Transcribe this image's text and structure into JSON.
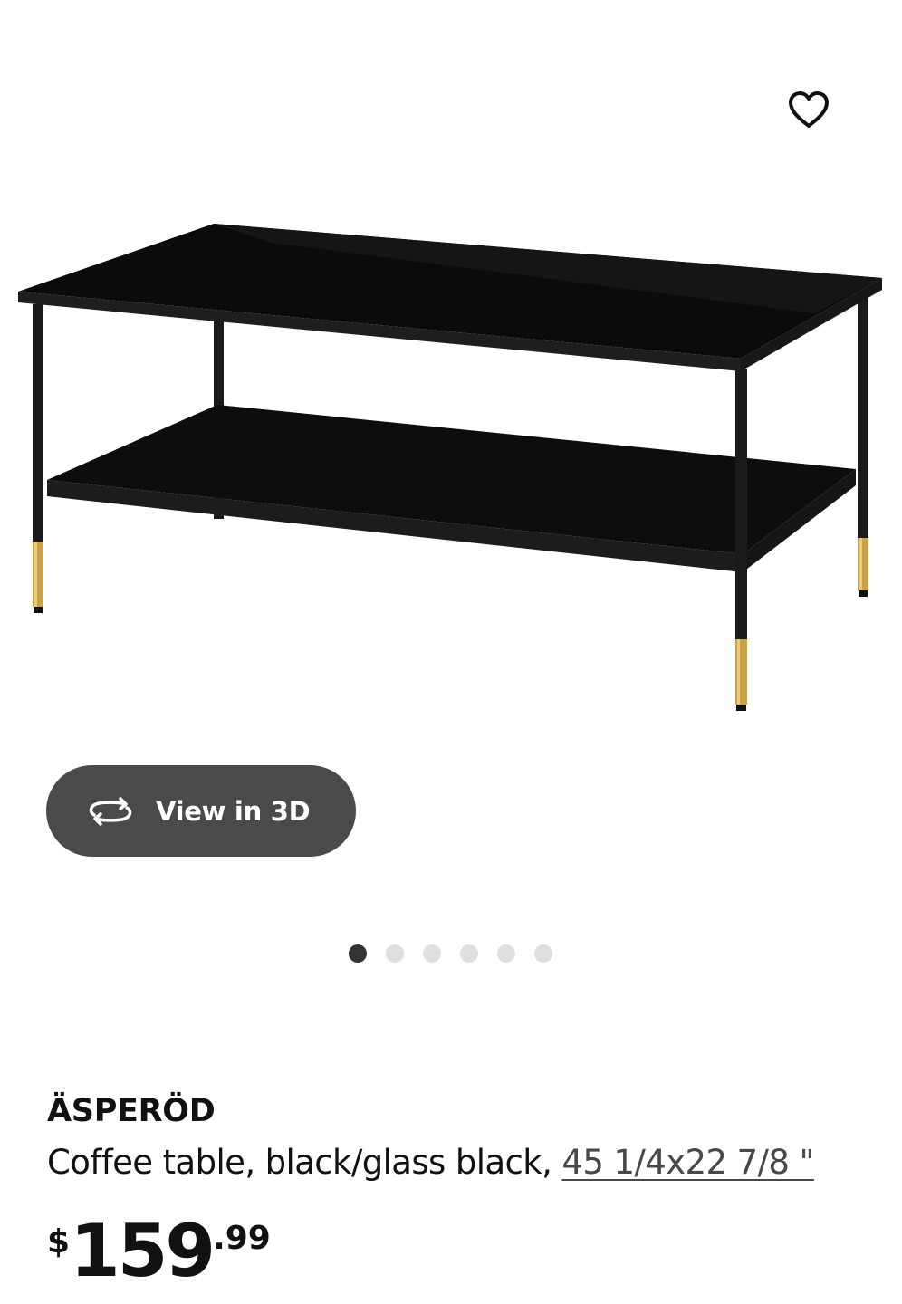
{
  "gallery": {
    "favorite_icon": "heart-outline-icon",
    "image_alt": "ÄSPERÖD coffee table",
    "view_3d": {
      "icon": "rotate-3d-icon",
      "label": "View in 3D"
    },
    "dots": {
      "count": 6,
      "active_index": 0
    }
  },
  "product": {
    "name": "ÄSPERÖD",
    "description": "Coffee table, black/glass black, ",
    "size": "45 1/4x22 7/8 \"",
    "price": {
      "currency": "$",
      "integer": "159",
      "decimal": ".99"
    }
  },
  "colors": {
    "button_bg": "#4a4a4a",
    "dot_active": "#333333",
    "dot_inactive": "#dfdfdf",
    "brass": "#c9a24a"
  }
}
